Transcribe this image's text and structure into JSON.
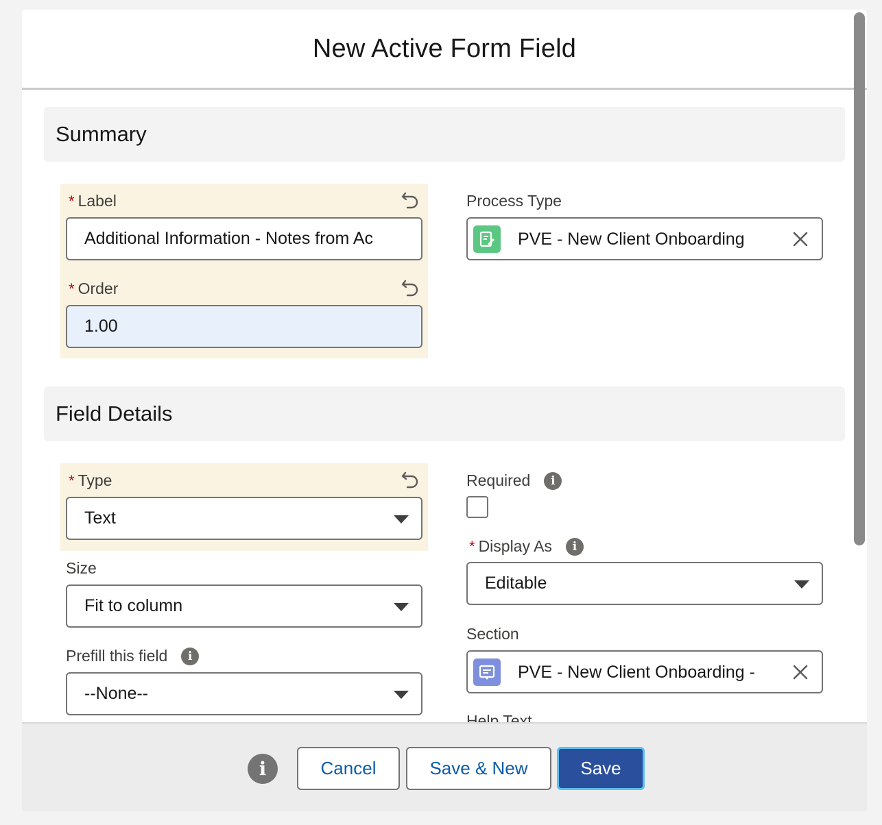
{
  "modal": {
    "title": "New Active Form Field"
  },
  "summary": {
    "title": "Summary",
    "label_field": {
      "label": "Label",
      "required_marker": "*",
      "value": "Additional Information - Notes from Ac"
    },
    "order_field": {
      "label": "Order",
      "required_marker": "*",
      "value": "1.00"
    },
    "process_type": {
      "label": "Process Type",
      "value": "PVE - New Client Onboarding",
      "icon": "process-type-icon",
      "icon_color": "#5bc782"
    }
  },
  "field_details": {
    "title": "Field Details",
    "type_field": {
      "label": "Type",
      "required_marker": "*",
      "value": "Text"
    },
    "size_field": {
      "label": "Size",
      "value": "Fit to column"
    },
    "prefill_field": {
      "label": "Prefill this field",
      "value": "--None--"
    },
    "required_field": {
      "label": "Required",
      "checked": false
    },
    "display_as_field": {
      "label": "Display As",
      "required_marker": "*",
      "value": "Editable"
    },
    "section_field": {
      "label": "Section",
      "value": "PVE - New Client Onboarding -",
      "icon": "section-icon",
      "icon_color": "#7d8fde"
    },
    "help_text_field": {
      "label": "Help Text",
      "value": ""
    }
  },
  "footer": {
    "cancel_label": "Cancel",
    "save_new_label": "Save & New",
    "save_label": "Save"
  },
  "colors": {
    "highlight": "#faf3e1",
    "primary": "#2a4f9c",
    "focus_ring": "#5bc0f0",
    "link": "#0b5cab",
    "required": "#ba0517"
  }
}
